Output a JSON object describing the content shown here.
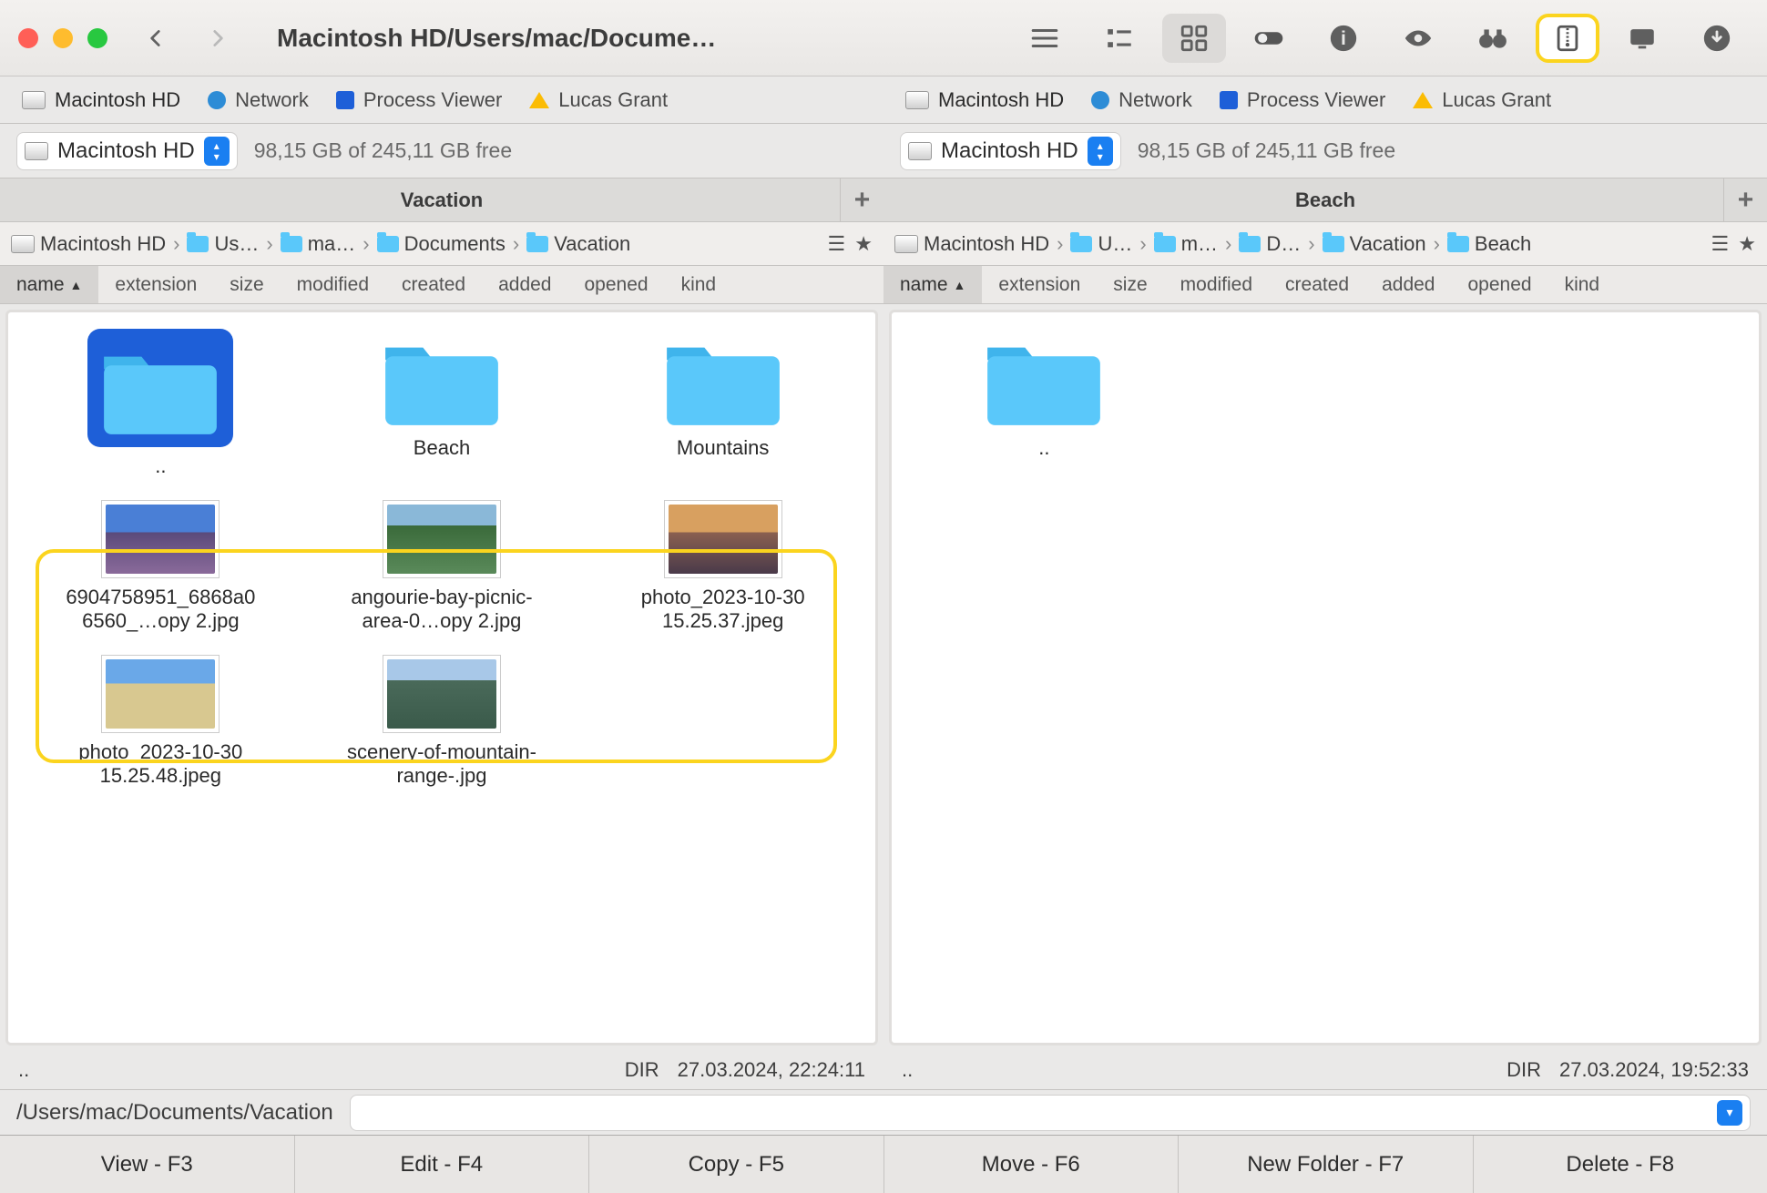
{
  "title": "Macintosh HD/Users/mac/Docume…",
  "toolbar": {
    "view_list": "list",
    "view_columns": "columns",
    "view_icons": "icons"
  },
  "tabs": {
    "left": [
      {
        "label": "Macintosh HD",
        "icon": "hd"
      },
      {
        "label": "Network",
        "icon": "globe"
      },
      {
        "label": "Process Viewer",
        "icon": "drive"
      },
      {
        "label": "Lucas Grant",
        "icon": "gdrive"
      }
    ],
    "right": [
      {
        "label": "Macintosh HD",
        "icon": "hd"
      },
      {
        "label": "Network",
        "icon": "globe"
      },
      {
        "label": "Process Viewer",
        "icon": "drive"
      },
      {
        "label": "Lucas Grant",
        "icon": "gdrive"
      }
    ]
  },
  "drive": {
    "left": {
      "name": "Macintosh HD",
      "free": "98,15 GB of 245,11 GB free"
    },
    "right": {
      "name": "Macintosh HD",
      "free": "98,15 GB of 245,11 GB free"
    }
  },
  "folder_title": {
    "left": "Vacation",
    "right": "Beach"
  },
  "breadcrumb": {
    "left": [
      "Macintosh HD",
      "Us…",
      "ma…",
      "Documents",
      "Vacation"
    ],
    "right": [
      "Macintosh HD",
      "U…",
      "m…",
      "D…",
      "Vacation",
      "Beach"
    ]
  },
  "columns": [
    "name",
    "extension",
    "size",
    "modified",
    "created",
    "added",
    "opened",
    "kind"
  ],
  "items": {
    "left": [
      {
        "type": "folder",
        "label": "..",
        "selected": true
      },
      {
        "type": "folder",
        "label": "Beach"
      },
      {
        "type": "folder",
        "label": "Mountains"
      },
      {
        "type": "image",
        "label": "6904758951_6868a06560_…opy 2.jpg",
        "thumb": "mountain"
      },
      {
        "type": "image",
        "label": "angourie-bay-picnic-area-0…opy 2.jpg",
        "thumb": "beach-green"
      },
      {
        "type": "image",
        "label": "photo_2023-10-30 15.25.37.jpeg",
        "thumb": "sunset"
      },
      {
        "type": "image",
        "label": "photo_2023-10-30 15.25.48.jpeg",
        "thumb": "beach-sand"
      },
      {
        "type": "image",
        "label": "scenery-of-mountain-range-.jpg",
        "thumb": "mountain2"
      }
    ],
    "right": [
      {
        "type": "folder",
        "label": ".."
      }
    ]
  },
  "status": {
    "left": {
      "dots": "..",
      "dir": "DIR",
      "datetime": "27.03.2024, 22:24:11"
    },
    "right": {
      "dots": "..",
      "dir": "DIR",
      "datetime": "27.03.2024, 19:52:33"
    }
  },
  "path_bar": "/Users/mac/Documents/Vacation",
  "bottom_buttons": [
    "View - F3",
    "Edit - F4",
    "Copy - F5",
    "Move - F6",
    "New Folder - F7",
    "Delete - F8"
  ]
}
